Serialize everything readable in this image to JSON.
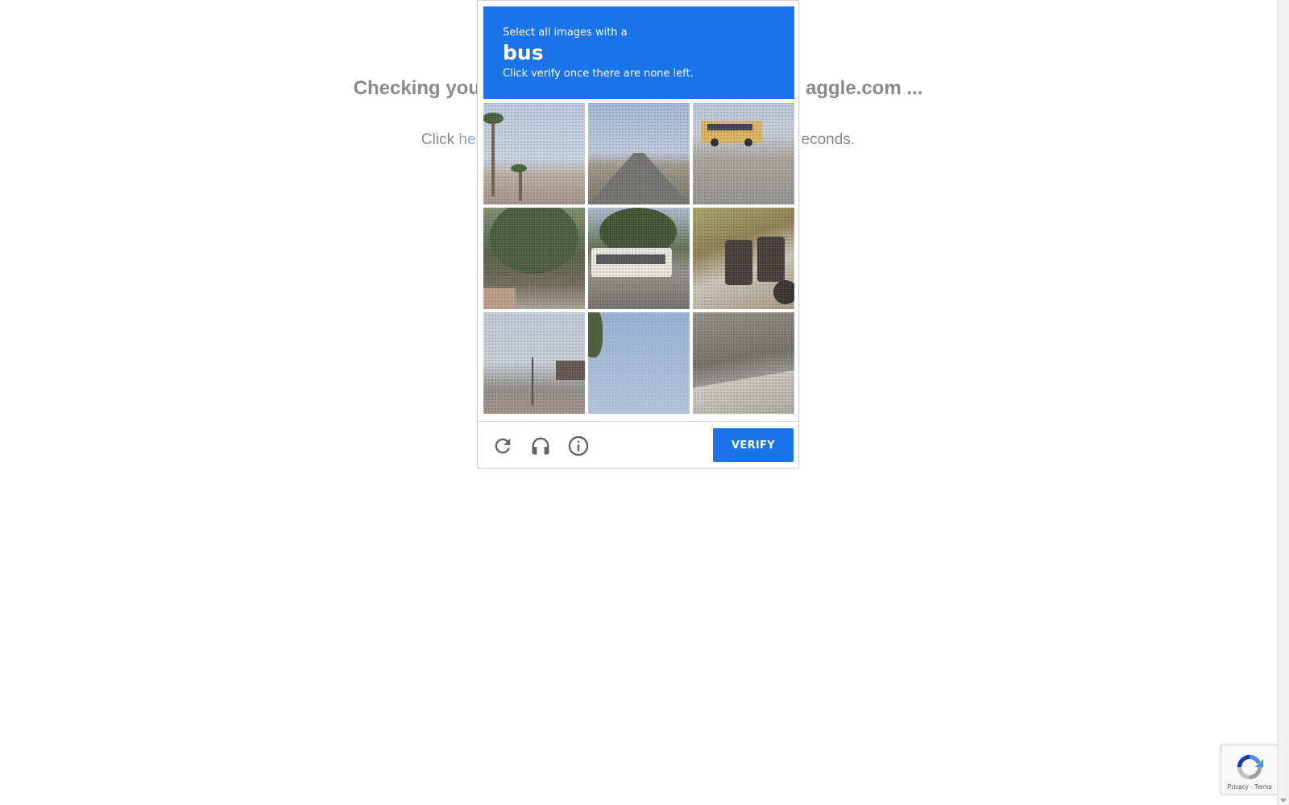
{
  "background_page": {
    "heading_left": "Checking you",
    "heading_right": "aggle.com ...",
    "line_prefix": "Click ",
    "link_text": "he",
    "line_suffix": "econds."
  },
  "captcha": {
    "instruction_line1": "Select all images with a",
    "target_object": "bus",
    "instruction_line2": "Click verify once there are none left.",
    "tiles": [
      {
        "description_icon": "palm-trees-tile"
      },
      {
        "description_icon": "road-tile"
      },
      {
        "description_icon": "school-bus-tile"
      },
      {
        "description_icon": "tree-house-tile"
      },
      {
        "description_icon": "bus-tree-tile"
      },
      {
        "description_icon": "bus-side-tile"
      },
      {
        "description_icon": "street-tile"
      },
      {
        "description_icon": "sky-palm-tile"
      },
      {
        "description_icon": "wall-tile"
      }
    ],
    "footer": {
      "reload_icon": "reload-icon",
      "audio_icon": "headphones-icon",
      "info_icon": "info-icon",
      "verify_label": "VERIFY"
    },
    "accent_color": "#1a73e8"
  },
  "recaptcha_badge": {
    "text": "Privacy - Terms"
  }
}
